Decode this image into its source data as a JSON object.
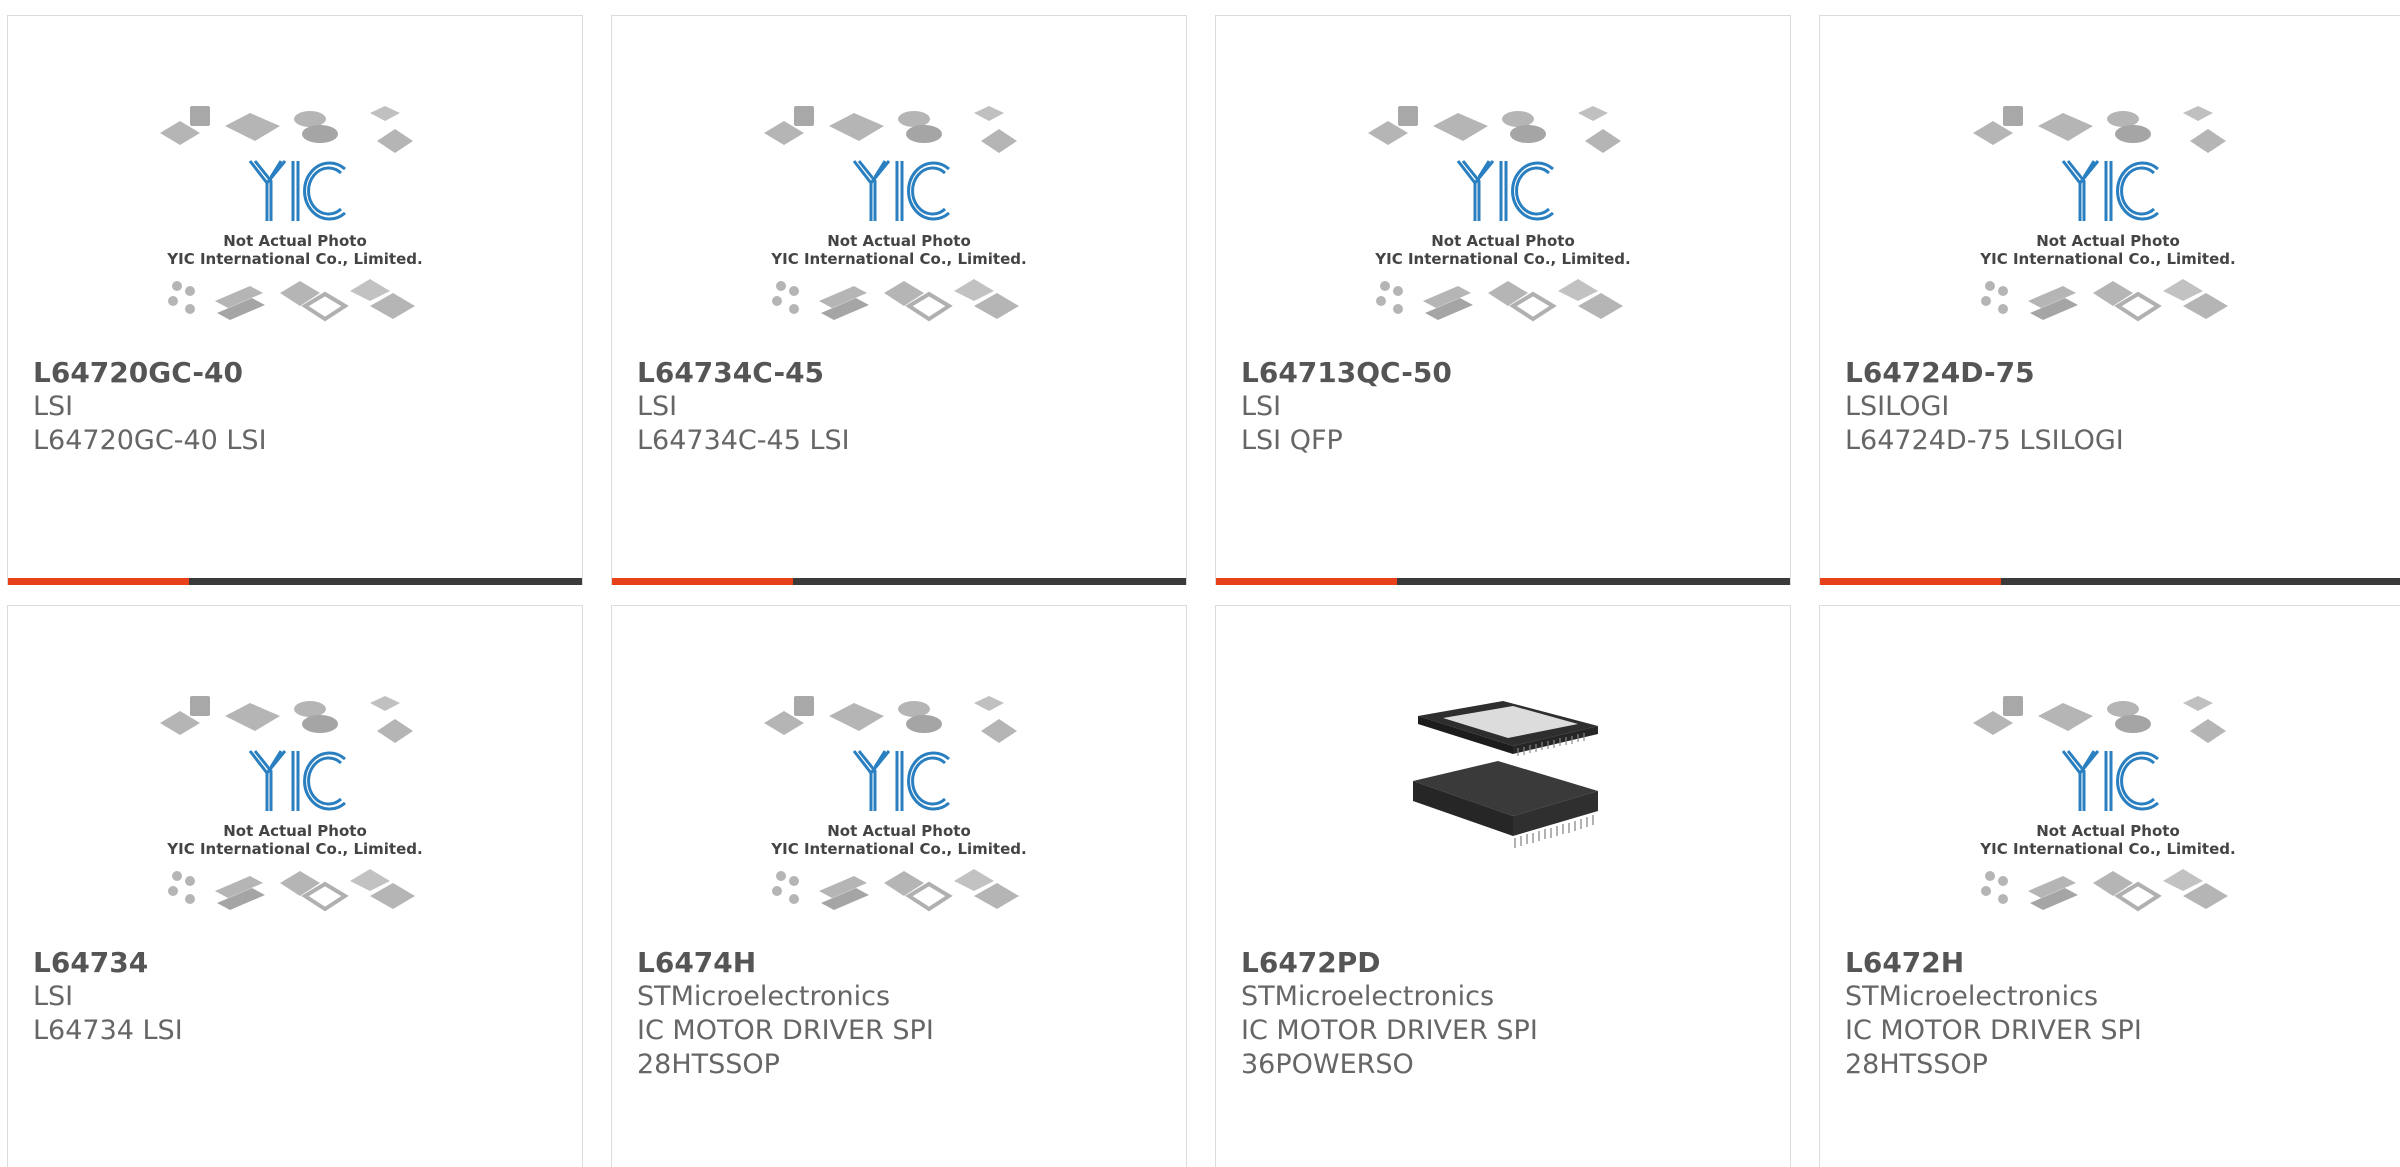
{
  "products": [
    {
      "part": "L64720GC-40",
      "brand": "LSI",
      "desc": [
        "L64720GC-40 LSI"
      ],
      "image": "placeholder"
    },
    {
      "part": "L64734C-45",
      "brand": "LSI",
      "desc": [
        "L64734C-45 LSI"
      ],
      "image": "placeholder"
    },
    {
      "part": "L64713QC-50",
      "brand": "LSI",
      "desc": [
        "LSI QFP"
      ],
      "image": "placeholder"
    },
    {
      "part": "L64724D-75",
      "brand": "LSILOGI",
      "desc": [
        "L64724D-75 LSILOGI"
      ],
      "image": "placeholder"
    },
    {
      "part": "L64734",
      "brand": "LSI",
      "desc": [
        "L64734 LSI"
      ],
      "image": "placeholder"
    },
    {
      "part": "L6474H",
      "brand": "STMicroelectronics",
      "desc": [
        "IC MOTOR DRIVER SPI",
        "28HTSSOP"
      ],
      "image": "placeholder"
    },
    {
      "part": "L6472PD",
      "brand": "STMicroelectronics",
      "desc": [
        "IC MOTOR DRIVER SPI",
        "36POWERSO"
      ],
      "image": "chip-photo"
    },
    {
      "part": "L6472H",
      "brand": "STMicroelectronics",
      "desc": [
        "IC MOTOR DRIVER SPI",
        "28HTSSOP"
      ],
      "image": "placeholder"
    }
  ],
  "placeholder": {
    "logo_text": "YIC",
    "caption1": "Not Actual Photo",
    "caption2": "YIC International Co., Limited."
  },
  "colors": {
    "accent": "#e8411a",
    "bar": "#3a3a3a",
    "logo": "#2a7fc0",
    "text": "#666666"
  }
}
